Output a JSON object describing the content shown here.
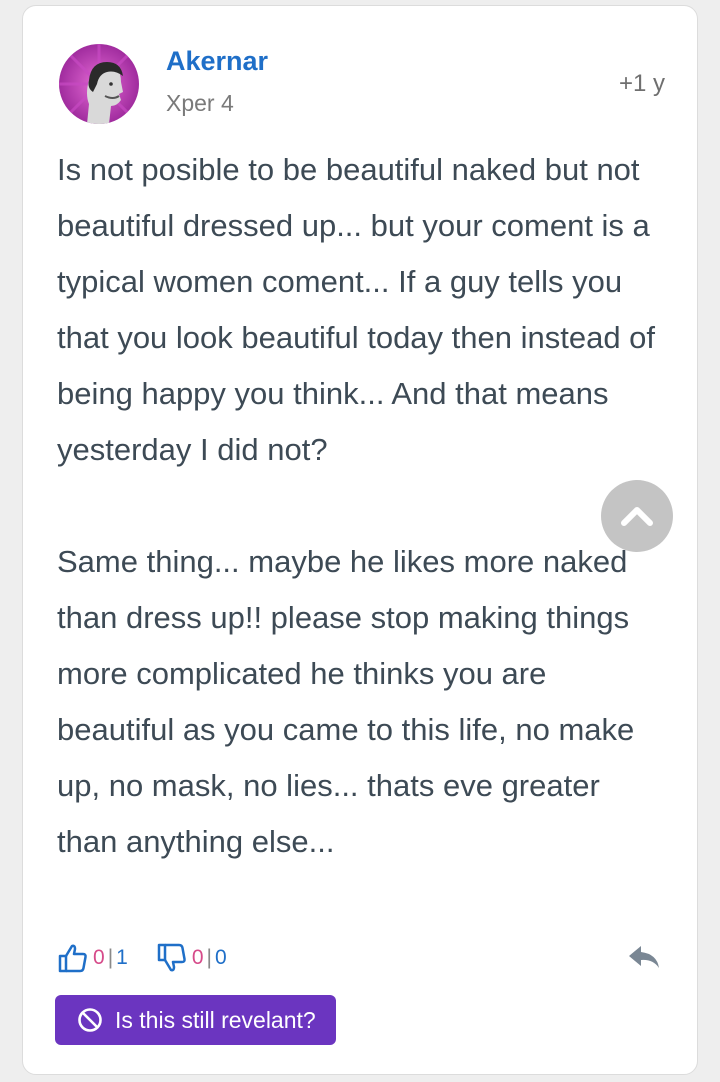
{
  "post": {
    "author": "Akernar",
    "xper": "Xper 4",
    "time": "+1 y",
    "paragraphs": [
      "Is not posible to be beautiful naked but not beautiful dressed up... but your coment is a typical women coment... If a guy tells you that you look beautiful today then instead of being happy you think... And that means yesterday I did not?",
      "Same thing... maybe he likes more naked than dress up!! please stop making things more complicated he thinks you are beautiful as you came to this life, no make up, no mask, no lies... thats eve greater than anything else..."
    ]
  },
  "actions": {
    "like": {
      "a": "0",
      "sep": "|",
      "b": "1"
    },
    "dislike": {
      "a": "0",
      "sep": "|",
      "b": "0"
    }
  },
  "relevant_label": "Is this still revelant?",
  "colors": {
    "author": "#1f6fc8",
    "button": "#6b35c0",
    "text": "#3d4a55",
    "scroll_button": "#c4c4c4"
  },
  "icons": [
    "user-avatar",
    "chevron-up-icon",
    "thumbs-up-icon",
    "thumbs-down-icon",
    "reply-icon",
    "ban-icon"
  ]
}
